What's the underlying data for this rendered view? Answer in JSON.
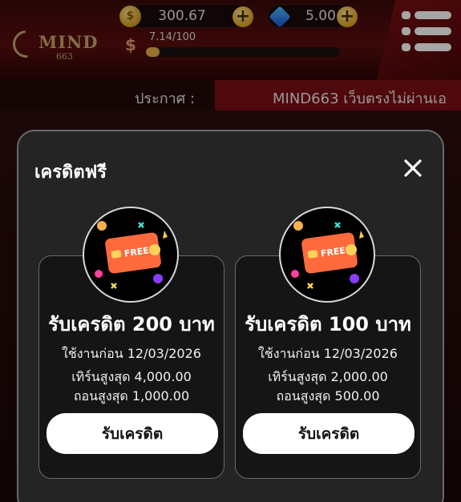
{
  "header": {
    "logo_text": "MIND",
    "logo_sub": "663",
    "coin_symbol": "$",
    "coin_balance": "300.67",
    "gem_balance": "5.00",
    "add_symbol": "+",
    "level_symbol": "$",
    "xp_text": "7.14/100",
    "xp_fraction": 0.0714
  },
  "announcement": {
    "label": "ประกาศ :",
    "text": "MIND663 เว็บตรงไม่ผ่านเอ"
  },
  "modal": {
    "title": "เครดิตฟรี",
    "cards": [
      {
        "badge_text": "FREE",
        "title": "รับเครดิต 200 บาท",
        "expire": "ใช้งานก่อน 12/03/2026",
        "turnover": "เทิร์นสูงสุด 4,000.00",
        "withdraw": "ถอนสูงสุด 1,000.00",
        "button_label": "รับเครดิต"
      },
      {
        "badge_text": "FREE",
        "title": "รับเครดิต 100 บาท",
        "expire": "ใช้งานก่อน 12/03/2026",
        "turnover": "เทิร์นสูงสุด 2,000.00",
        "withdraw": "ถอนสูงสุด 500.00",
        "button_label": "รับเครดิต"
      }
    ]
  },
  "colors": {
    "accent_gold": "#e8b04a",
    "header_red": "#7a0d12",
    "modal_bg": "#242424"
  },
  "icons": [
    "coin-icon",
    "gem-icon",
    "plus-icon",
    "menu-icon",
    "close-icon",
    "credit-card-icon"
  ]
}
